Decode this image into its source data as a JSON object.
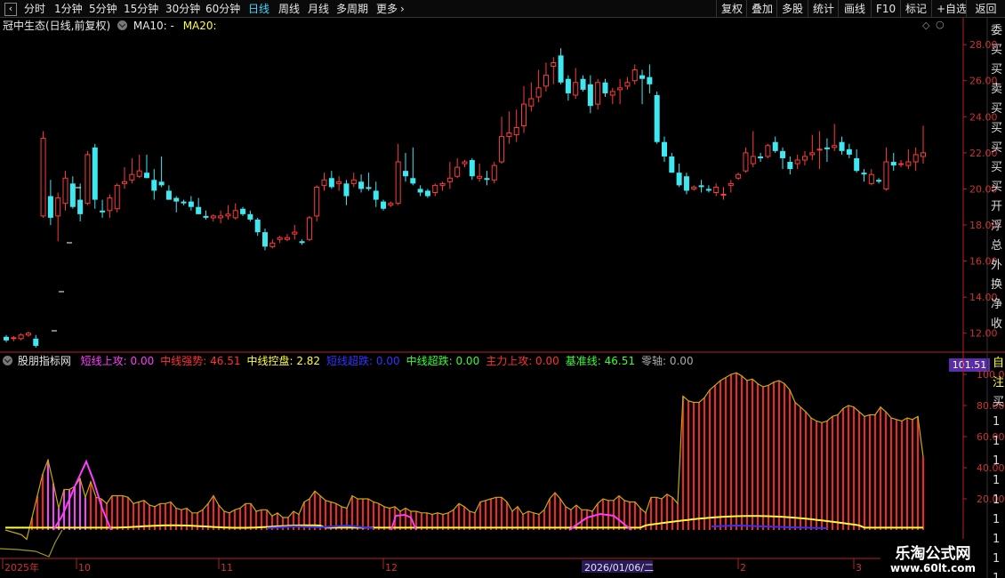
{
  "toolbar": {
    "back_glyph": "‹",
    "periods": [
      "分时",
      "1分钟",
      "5分钟",
      "15分钟",
      "30分钟",
      "60分钟",
      "日线",
      "周线",
      "月线",
      "多周期",
      "更多"
    ],
    "active_period": "日线",
    "more_arrow": "›",
    "right_buttons": [
      "复权",
      "叠加",
      "多股",
      "统计",
      "画线",
      "F10",
      "标记",
      "+自选",
      "返回"
    ]
  },
  "main_chart": {
    "title": "冠中生态(日线,前复权)",
    "ma10_label": "MA10: -",
    "ma20_label": "MA20:",
    "y_ticks": [
      "28.00",
      "26.00",
      "24.00",
      "22.00",
      "20.00",
      "18.00",
      "16.00",
      "14.00",
      "12.00"
    ],
    "diamond_glyph": "◇",
    "circle_glyph": "○",
    "right_strip_chars": [
      "委",
      "买",
      "买",
      "卖",
      "买",
      "买",
      "买",
      "买",
      "买",
      "开",
      "浮",
      "总",
      "外",
      "换",
      "净",
      "收"
    ]
  },
  "indicator": {
    "name": "股朋指标网",
    "items": [
      {
        "label": "短线上攻:",
        "value": "0.00",
        "color": "#ff3cff"
      },
      {
        "label": "中线强势:",
        "value": "46.51",
        "color": "#ff3333"
      },
      {
        "label": "中线控盘:",
        "value": "2.82",
        "color": "#ffff33"
      },
      {
        "label": "短线超跌:",
        "value": "0.00",
        "color": "#3333ff"
      },
      {
        "label": "中线超跌:",
        "value": "0.00",
        "color": "#33ff33"
      },
      {
        "label": "主力上攻:",
        "value": "0.00",
        "color": "#ff3333"
      },
      {
        "label": "基准线:",
        "value": "46.51",
        "color": "#33ff33"
      },
      {
        "label": "零轴:",
        "value": "0.00",
        "color": "#aaaaaa"
      }
    ],
    "y_ticks": [
      "100.00",
      "80.00",
      "60.00",
      "40.00",
      "20.00"
    ],
    "current_value": "101.51",
    "right_strip_chars": [
      "自",
      "注",
      "买",
      "1",
      "1",
      "1",
      "1",
      "1",
      "1",
      "1",
      "1",
      "1"
    ]
  },
  "x_axis": {
    "labels": [
      "2025年",
      "10",
      "11",
      "12",
      "2026/01/06/二",
      "2",
      "3"
    ]
  },
  "watermark": {
    "line1": "乐淘公式网",
    "line2": "www.60lt.com"
  },
  "colors": {
    "up": "#ff3b3b",
    "down": "#3fe8f0",
    "axis": "#b22222",
    "bar_red": "#ff2020",
    "yellow": "#ffff33",
    "magenta": "#ff3cff",
    "blue": "#3333ff",
    "active_tab": "#3fd7ff",
    "value_box": "#5a2ea6"
  },
  "chart_data": {
    "type": "candlestick",
    "candles": [
      [
        11.8,
        11.9,
        11.5,
        11.6
      ],
      [
        11.7,
        11.85,
        11.55,
        11.75
      ],
      [
        11.7,
        12.0,
        11.6,
        11.9
      ],
      [
        11.9,
        12.1,
        11.8,
        12.0
      ],
      [
        11.7,
        11.9,
        11.2,
        11.3
      ],
      [
        18.5,
        23.2,
        18.4,
        22.8
      ],
      [
        19.6,
        20.5,
        18.0,
        18.4
      ],
      [
        18.5,
        19.8,
        17.1,
        19.5
      ],
      [
        19.2,
        21.0,
        18.8,
        20.6
      ],
      [
        20.3,
        20.7,
        18.9,
        19.0
      ],
      [
        19.4,
        20.3,
        18.2,
        18.6
      ],
      [
        19.2,
        22.1,
        19.1,
        21.9
      ],
      [
        22.3,
        22.5,
        18.9,
        19.4
      ],
      [
        18.8,
        19.4,
        18.4,
        18.7
      ],
      [
        18.8,
        19.7,
        18.4,
        19.5
      ],
      [
        18.9,
        20.3,
        18.7,
        20.2
      ],
      [
        20.3,
        21.2,
        20.0,
        20.4
      ],
      [
        20.5,
        21.7,
        20.3,
        20.8
      ],
      [
        20.7,
        21.9,
        20.6,
        21.0
      ],
      [
        20.9,
        21.9,
        20.6,
        20.6
      ],
      [
        20.5,
        21.1,
        19.4,
        19.9
      ],
      [
        20.4,
        21.8,
        20.1,
        20.2
      ],
      [
        19.9,
        20.2,
        19.4,
        19.4
      ],
      [
        19.5,
        19.6,
        18.7,
        19.3
      ],
      [
        19.3,
        19.4,
        19.1,
        19.2
      ],
      [
        19.3,
        19.6,
        18.8,
        19.0
      ],
      [
        19.0,
        19.5,
        18.6,
        18.6
      ],
      [
        18.5,
        18.8,
        18.3,
        18.4
      ],
      [
        18.4,
        18.6,
        18.2,
        18.5
      ],
      [
        18.4,
        18.8,
        18.1,
        18.5
      ],
      [
        18.5,
        19.1,
        18.3,
        18.6
      ],
      [
        18.4,
        19.2,
        18.3,
        18.8
      ],
      [
        18.9,
        19.0,
        18.5,
        18.6
      ],
      [
        18.6,
        18.8,
        18.2,
        18.3
      ],
      [
        18.3,
        18.4,
        17.4,
        17.6
      ],
      [
        17.6,
        17.8,
        16.6,
        16.8
      ],
      [
        16.8,
        17.2,
        16.7,
        17.0
      ],
      [
        17.2,
        17.4,
        17.0,
        17.3
      ],
      [
        17.2,
        17.5,
        17.1,
        17.3
      ],
      [
        17.5,
        18.0,
        17.2,
        17.6
      ],
      [
        17.1,
        17.2,
        16.9,
        17.0
      ],
      [
        17.2,
        18.5,
        17.1,
        18.4
      ],
      [
        18.5,
        20.2,
        18.2,
        20.1
      ],
      [
        20.2,
        20.9,
        19.9,
        20.5
      ],
      [
        20.6,
        21.0,
        20.0,
        20.1
      ],
      [
        20.3,
        20.7,
        19.9,
        20.4
      ],
      [
        20.3,
        20.5,
        19.1,
        19.6
      ],
      [
        20.3,
        20.9,
        20.1,
        20.5
      ],
      [
        20.4,
        20.8,
        19.8,
        20.0
      ],
      [
        20.1,
        20.9,
        19.9,
        20.0
      ],
      [
        19.9,
        20.4,
        19.0,
        19.4
      ],
      [
        19.3,
        19.4,
        18.8,
        18.9
      ],
      [
        19.1,
        19.3,
        19.0,
        19.2
      ],
      [
        19.2,
        22.5,
        19.1,
        21.5
      ],
      [
        21.0,
        22.0,
        20.4,
        20.7
      ],
      [
        20.6,
        22.3,
        20.2,
        20.3
      ],
      [
        20.0,
        20.2,
        19.6,
        19.8
      ],
      [
        19.9,
        20.0,
        19.5,
        19.6
      ],
      [
        19.8,
        20.3,
        19.6,
        20.2
      ],
      [
        20.2,
        20.4,
        19.9,
        20.3
      ],
      [
        20.4,
        21.5,
        20.0,
        20.6
      ],
      [
        20.7,
        21.7,
        20.6,
        21.2
      ],
      [
        21.4,
        21.6,
        21.2,
        21.5
      ],
      [
        21.6,
        21.7,
        20.5,
        20.7
      ],
      [
        20.6,
        21.4,
        20.4,
        20.7
      ],
      [
        20.6,
        21.0,
        20.2,
        20.5
      ],
      [
        20.5,
        21.5,
        20.3,
        21.3
      ],
      [
        21.5,
        24.0,
        21.4,
        22.9
      ],
      [
        22.9,
        24.3,
        22.5,
        23.1
      ],
      [
        23.0,
        24.4,
        22.6,
        23.4
      ],
      [
        23.5,
        25.7,
        23.1,
        24.7
      ],
      [
        24.6,
        25.9,
        24.3,
        25.0
      ],
      [
        25.1,
        26.6,
        24.8,
        25.6
      ],
      [
        25.7,
        27.0,
        25.4,
        26.3
      ],
      [
        26.8,
        27.3,
        25.8,
        27.0
      ],
      [
        27.4,
        27.8,
        25.8,
        25.9
      ],
      [
        26.1,
        26.3,
        24.9,
        25.3
      ],
      [
        25.2,
        26.7,
        25.0,
        25.9
      ],
      [
        26.1,
        26.3,
        25.4,
        25.5
      ],
      [
        25.8,
        26.3,
        24.2,
        24.6
      ],
      [
        24.7,
        26.1,
        24.4,
        25.9
      ],
      [
        25.9,
        26.1,
        25.1,
        25.3
      ],
      [
        25.2,
        25.6,
        24.7,
        25.4
      ],
      [
        25.5,
        26.1,
        24.7,
        25.6
      ],
      [
        25.7,
        26.2,
        25.5,
        25.9
      ],
      [
        26.0,
        26.9,
        25.8,
        26.6
      ],
      [
        26.3,
        26.6,
        24.7,
        26.1
      ],
      [
        26.2,
        26.9,
        25.3,
        25.8
      ],
      [
        25.2,
        25.4,
        22.5,
        22.6
      ],
      [
        22.6,
        22.9,
        21.5,
        21.8
      ],
      [
        21.8,
        22.0,
        20.9,
        20.9
      ],
      [
        20.9,
        21.4,
        20.1,
        20.2
      ],
      [
        20.7,
        20.9,
        19.7,
        19.9
      ],
      [
        20.0,
        20.2,
        19.9,
        20.1
      ],
      [
        20.2,
        20.5,
        19.8,
        20.1
      ],
      [
        20.0,
        20.2,
        19.8,
        19.9
      ],
      [
        19.8,
        20.3,
        19.6,
        20.1
      ],
      [
        19.7,
        20.1,
        19.4,
        19.7
      ],
      [
        20.2,
        20.5,
        19.8,
        20.3
      ],
      [
        20.6,
        20.9,
        20.5,
        20.8
      ],
      [
        21.0,
        22.3,
        20.9,
        22.0
      ],
      [
        21.4,
        23.2,
        21.2,
        21.8
      ],
      [
        21.8,
        22.0,
        21.5,
        21.7
      ],
      [
        21.8,
        22.5,
        21.7,
        22.4
      ],
      [
        22.6,
        22.9,
        22.0,
        22.1
      ],
      [
        22.1,
        22.3,
        21.1,
        21.7
      ],
      [
        21.5,
        21.8,
        20.8,
        21.1
      ],
      [
        21.4,
        21.9,
        21.1,
        21.6
      ],
      [
        21.6,
        22.1,
        21.3,
        21.8
      ],
      [
        21.9,
        23.0,
        21.6,
        22.0
      ],
      [
        22.2,
        23.2,
        21.1,
        22.2
      ],
      [
        22.3,
        22.8,
        21.5,
        22.2
      ],
      [
        22.3,
        23.6,
        22.1,
        22.4
      ],
      [
        22.6,
        22.9,
        21.9,
        22.1
      ],
      [
        22.2,
        22.5,
        21.7,
        21.9
      ],
      [
        21.7,
        22.2,
        20.9,
        21.0
      ],
      [
        20.9,
        21.1,
        20.4,
        20.8
      ],
      [
        20.3,
        21.1,
        20.2,
        20.8
      ],
      [
        20.5,
        20.6,
        20.3,
        20.4
      ],
      [
        20.0,
        22.3,
        19.9,
        21.5
      ],
      [
        21.5,
        22.0,
        21.0,
        21.3
      ],
      [
        21.4,
        21.6,
        21.2,
        21.4
      ],
      [
        21.3,
        22.2,
        21.1,
        21.5
      ],
      [
        21.5,
        22.3,
        21.0,
        21.9
      ],
      [
        21.8,
        23.5,
        21.4,
        22.0
      ]
    ],
    "ylim": [
      11.0,
      28.6
    ],
    "indicator_series": {
      "bars_中线强势": [
        0,
        0,
        0,
        0,
        0,
        0,
        0,
        0,
        0,
        0,
        0,
        0,
        0,
        0,
        0,
        0,
        0,
        0,
        0,
        0,
        0,
        0,
        0,
        0,
        0,
        0,
        0,
        0,
        0,
        0,
        0,
        0,
        0,
        0,
        0,
        0,
        0,
        0,
        0,
        0,
        0,
        0,
        0,
        0,
        0,
        0,
        0,
        0,
        0,
        0,
        0,
        0,
        0,
        0,
        0,
        0,
        0,
        0,
        0,
        0,
        0,
        0,
        0,
        0,
        0,
        0,
        0,
        0,
        0,
        0,
        0,
        0,
        0,
        0,
        0,
        0,
        0,
        0,
        0,
        0,
        0,
        0,
        0,
        0,
        0,
        0,
        0,
        0,
        0,
        0,
        0,
        0,
        0,
        0,
        0,
        0,
        0,
        0,
        0,
        0,
        0,
        0,
        0,
        0,
        0,
        0,
        0,
        0,
        0,
        0,
        0,
        0,
        0,
        0,
        0,
        0,
        0,
        0,
        0,
        0,
        0,
        0,
        0,
        0,
        0
      ],
      "line_中线控盘": [
        1.5,
        1.5,
        1.5,
        1.5,
        1.5,
        1.5,
        2.0,
        2.0,
        2.5,
        3.0,
        3.5,
        4.0,
        4.5,
        4.5,
        4.0,
        3.5,
        3.0,
        3.0,
        2.5,
        2.5,
        2.5,
        2.5,
        2.5,
        2.5,
        2.5,
        2.5,
        2.5,
        2.5,
        2.5,
        2.5,
        2.5,
        2.5,
        2.5,
        2.5,
        2.5,
        2.5,
        2.5,
        2.5,
        2.5,
        2.5,
        2.5,
        2.5,
        2.5,
        2.5,
        2.5,
        2.5,
        2.5,
        2.5,
        2.5,
        2.5,
        2.5,
        2.5,
        2.5,
        2.5,
        2.5,
        2.5,
        2.5,
        2.5,
        2.5,
        2.5,
        2.5,
        2.5,
        2.5,
        2.5,
        2.5,
        2.5,
        2.5,
        2.5,
        3.0,
        3.5,
        4.0,
        4.5,
        5.0,
        5.5,
        6.0,
        6.5,
        7.0,
        7.0,
        7.0,
        7.0,
        7.0,
        7.0,
        7.0,
        7.0,
        7.0,
        7.0,
        6.5,
        6.0,
        5.5,
        5.0,
        4.5,
        4.0,
        3.5,
        3.0,
        3.0,
        3.0,
        3.0,
        3.0,
        3.0,
        3.0,
        3.0,
        3.0,
        3.0,
        3.0,
        3.0,
        3.0,
        3.0,
        3.0,
        3.0,
        3.0,
        3.0,
        3.0,
        3.0,
        3.0,
        3.0,
        3.0,
        3.0,
        3.0,
        3.0,
        3.0,
        3.0,
        3.0,
        3.0,
        3.0,
        3.0
      ]
    },
    "indicator_envelope": [
      0,
      -1,
      -2,
      -3,
      -4,
      5,
      15,
      30,
      40,
      45,
      32,
      22,
      22,
      24,
      25,
      20,
      28,
      31,
      35,
      33,
      27,
      24,
      23,
      17,
      21,
      22,
      22,
      21,
      21,
      22,
      22,
      20,
      17,
      16,
      14,
      13,
      13,
      14,
      17,
      22,
      21,
      14,
      20,
      20,
      17,
      14,
      14,
      11,
      13,
      13,
      14,
      12,
      14,
      10,
      12,
      9,
      10,
      9,
      13,
      12,
      13,
      12,
      13,
      11,
      9,
      12,
      15,
      18,
      20,
      19,
      21,
      20,
      18,
      17,
      17,
      14,
      18,
      17,
      18,
      13,
      18,
      14,
      12,
      17,
      21,
      23,
      18,
      16,
      16,
      15,
      14,
      15,
      12,
      9,
      16,
      12,
      10,
      13,
      20,
      16,
      11,
      17,
      17,
      14,
      12,
      13,
      15,
      18,
      16,
      18,
      18,
      18,
      17,
      16,
      15,
      12,
      14,
      12,
      13,
      14,
      10,
      12,
      7,
      9,
      17
    ],
    "indicator_main": [
      0,
      0,
      0,
      0,
      0,
      0,
      0,
      0,
      0,
      0,
      0,
      0,
      0,
      0,
      0,
      0,
      0,
      0,
      0,
      0,
      0,
      0,
      0,
      0,
      0,
      0,
      0,
      0,
      0,
      0,
      0,
      0,
      0,
      0,
      0,
      0,
      0,
      0,
      0,
      0,
      0,
      0,
      0,
      0,
      0,
      0,
      0,
      0,
      0,
      0,
      0,
      0,
      0,
      0,
      0,
      0,
      0,
      0,
      0,
      0,
      0,
      0,
      0,
      0,
      0,
      0,
      0,
      0,
      0,
      0,
      0,
      0,
      0,
      0,
      0,
      0,
      0,
      0,
      0,
      0,
      0,
      0,
      0,
      0,
      0,
      0,
      0,
      0,
      0,
      0,
      0,
      0,
      0,
      0,
      0,
      0,
      0,
      0,
      0,
      0,
      0,
      0,
      0,
      0,
      0,
      0,
      0,
      0,
      0,
      0,
      0,
      0,
      0,
      0,
      0,
      0,
      0,
      0,
      0,
      0,
      0,
      0,
      0,
      0,
      0
    ],
    "indicator_levels": [
      0,
      -1,
      -2,
      -3,
      -6,
      8,
      22,
      36,
      45,
      30,
      14,
      26,
      26,
      28,
      33,
      21,
      31,
      21,
      20,
      17,
      22,
      22,
      22,
      21,
      17,
      18,
      19,
      16,
      15,
      17,
      17,
      18,
      14,
      13,
      14,
      11,
      11,
      13,
      17,
      22,
      16,
      12,
      11,
      13,
      14,
      17,
      17,
      12,
      13,
      13,
      9,
      11,
      8,
      8,
      12,
      10,
      18,
      20,
      25,
      22,
      19,
      18,
      17,
      15,
      14,
      22,
      20,
      20,
      20,
      18,
      17,
      15,
      14,
      15,
      12,
      14,
      12,
      12,
      11,
      11,
      10,
      11,
      10,
      11,
      13,
      17,
      15,
      12,
      11,
      18,
      19,
      20,
      21,
      21,
      18,
      12,
      15,
      10,
      12,
      11,
      10,
      13,
      20,
      24,
      20,
      15,
      13,
      16,
      13,
      13,
      12,
      17,
      20,
      19,
      19,
      22,
      19,
      18,
      18,
      14,
      11,
      21,
      21,
      20,
      23,
      21,
      17,
      86,
      83,
      82,
      82,
      85,
      90,
      93,
      96,
      98,
      100,
      101,
      99,
      96,
      97,
      94,
      92,
      93,
      95,
      96,
      94,
      90,
      82,
      79,
      76,
      72,
      70,
      69,
      70,
      73,
      74,
      78,
      80,
      79,
      76,
      73,
      74,
      74,
      79,
      76,
      72,
      71,
      70,
      72,
      71,
      73,
      47
    ]
  }
}
